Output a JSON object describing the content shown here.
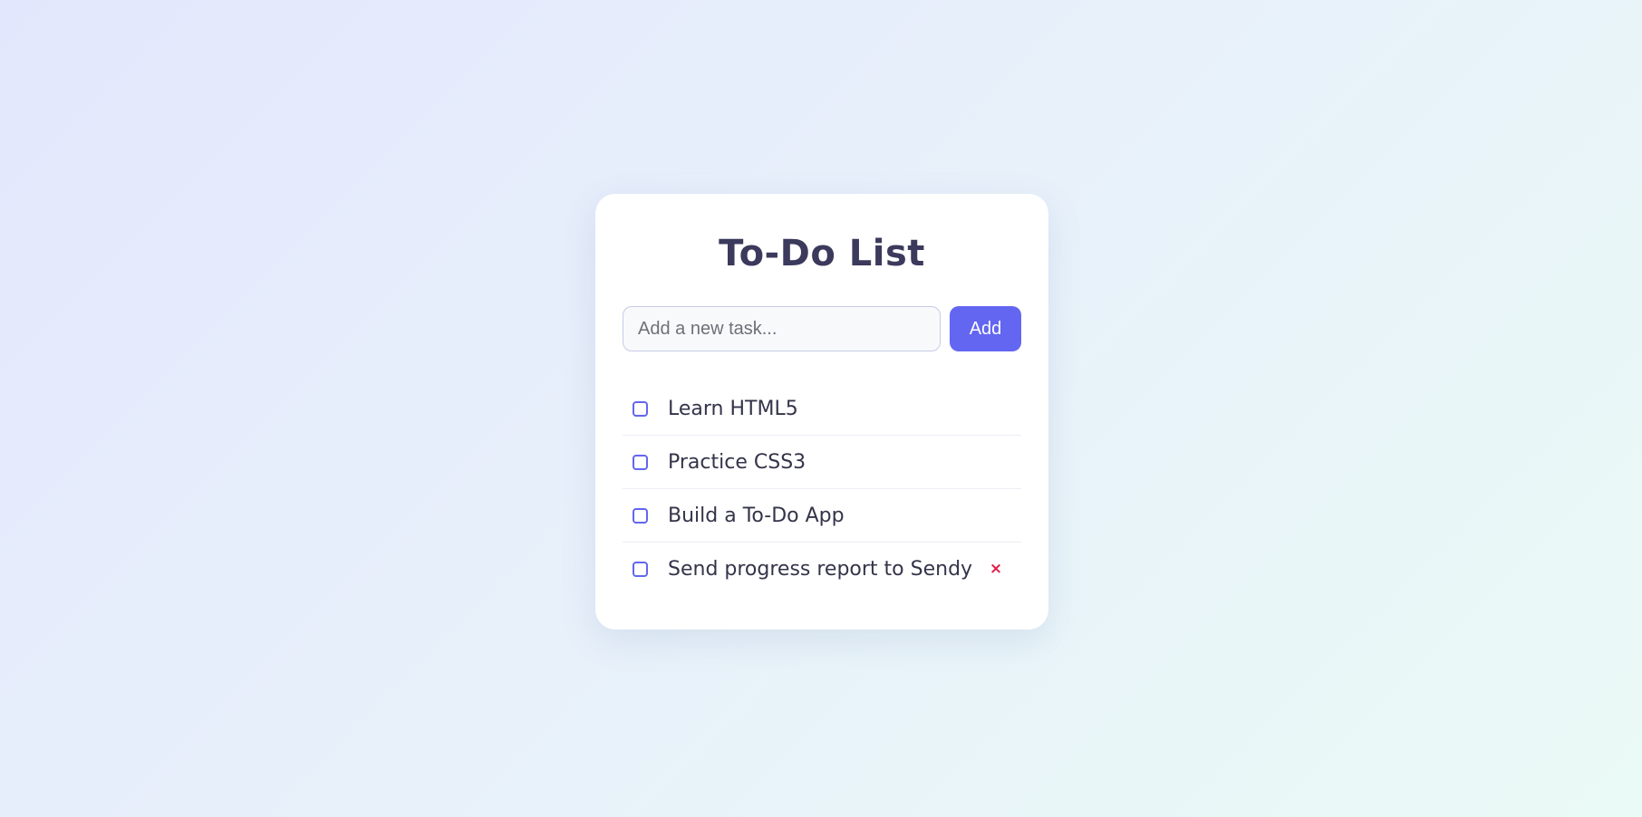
{
  "app": {
    "title": "To-Do List"
  },
  "new_task": {
    "placeholder": "Add a new task...",
    "value": "",
    "add_label": "Add"
  },
  "tasks": [
    {
      "label": "Learn HTML5",
      "completed": false
    },
    {
      "label": "Practice CSS3",
      "completed": false
    },
    {
      "label": "Build a To-Do App",
      "completed": false
    },
    {
      "label": "Send progress report to Sendy",
      "completed": false,
      "delete_label": "×"
    }
  ],
  "colors": {
    "accent": "#6366f1",
    "title": "#3b3a5c",
    "delete": "#e11d48",
    "card": "#ffffff"
  },
  "icons": {
    "delete": "close-icon",
    "checkbox": "checkbox-unchecked-icon"
  }
}
